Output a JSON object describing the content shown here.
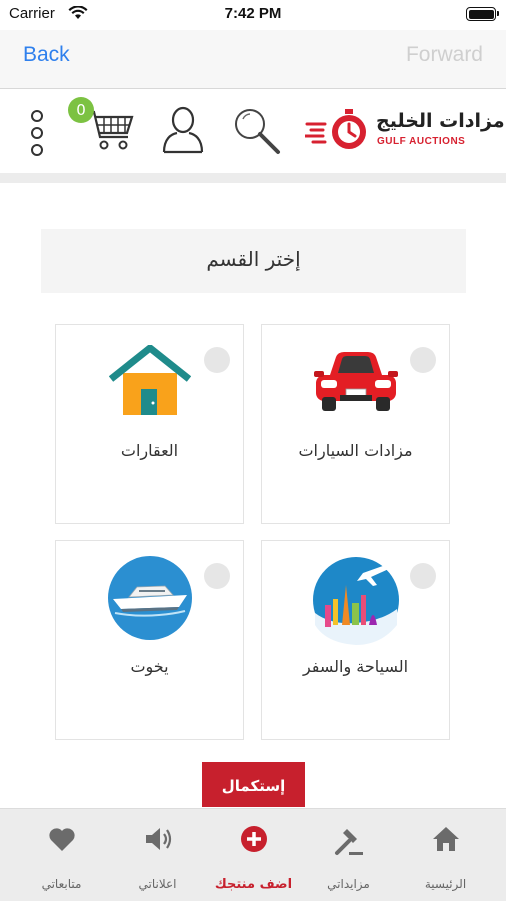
{
  "status_bar": {
    "carrier": "Carrier",
    "time": "7:42 PM"
  },
  "nav": {
    "back_label": "Back",
    "forward_label": "Forward"
  },
  "header": {
    "cart_count": "0",
    "logo": {
      "title": "مزادات الخليج",
      "subtitle": "GULF AUCTIONS"
    }
  },
  "page": {
    "section_title": "إختر القسم",
    "categories": [
      {
        "label": "مزادات السيارات",
        "icon": "car-icon"
      },
      {
        "label": "العقارات",
        "icon": "house-icon"
      },
      {
        "label": "السياحة والسفر",
        "icon": "travel-icon"
      },
      {
        "label": "يخوت",
        "icon": "yacht-icon"
      }
    ],
    "continue_label": "إستكمال"
  },
  "tabbar": {
    "items": [
      {
        "label": "الرئيسية",
        "icon": "home-icon"
      },
      {
        "label": "مزايداتي",
        "icon": "gavel-icon"
      },
      {
        "label": "اضف منتجك",
        "icon": "add-circle-icon",
        "active": true
      },
      {
        "label": "اعلاناتي",
        "icon": "speaker-icon"
      },
      {
        "label": "متابعاتي",
        "icon": "heart-icon"
      }
    ]
  },
  "colors": {
    "accent": "#c7202d",
    "link": "#2f80ed",
    "badge": "#7cc242"
  }
}
